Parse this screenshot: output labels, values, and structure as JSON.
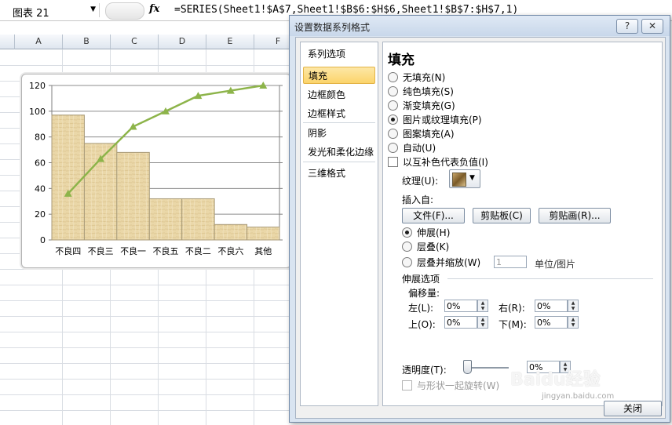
{
  "formula_bar": {
    "name_box": "图表 21",
    "fx": "fx",
    "formula": "=SERIES(Sheet1!$A$7,Sheet1!$B$6:$H$6,Sheet1!$B$7:$H$7,1)"
  },
  "sheet": {
    "columns": [
      "A",
      "B",
      "C",
      "D",
      "E",
      "F"
    ]
  },
  "chart_data": {
    "type": "bar",
    "categories": [
      "不良四",
      "不良三",
      "不良一",
      "不良五",
      "不良二",
      "不良六",
      "其他"
    ],
    "series": [
      {
        "values": [
          97,
          75,
          68,
          32,
          32,
          12,
          10
        ]
      },
      {
        "values": [
          36,
          63,
          88,
          100,
          112,
          116,
          120
        ]
      }
    ],
    "yticks": [
      "0",
      "20",
      "40",
      "60",
      "80",
      "100",
      "120"
    ],
    "ylim": [
      0,
      120
    ],
    "grid": true,
    "colors": {
      "bar_fill": "#ead7a8",
      "bar_stroke": "#a89a78",
      "line": "#8db44a"
    }
  },
  "dialog": {
    "title": "设置数据系列格式",
    "help": "?",
    "close_x": "✕",
    "nav": [
      "系列选项",
      "填充",
      "边框颜色",
      "边框样式",
      "阴影",
      "发光和柔化边缘",
      "三维格式"
    ],
    "nav_selected": "填充",
    "panel": {
      "title": "填充",
      "fill_options": [
        "无填充(N)",
        "纯色填充(S)",
        "渐变填充(G)",
        "图片或纹理填充(P)",
        "图案填充(A)",
        "自动(U)"
      ],
      "fill_selected": "图片或纹理填充(P)",
      "invert_if_negative": "以互补色代表负值(I)",
      "texture_label": "纹理(U):",
      "insert_from": "插入自:",
      "buttons": [
        "文件(F)...",
        "剪贴板(C)",
        "剪贴画(R)..."
      ],
      "stretch_options": [
        "伸展(H)",
        "层叠(K)",
        "层叠并缩放(W)"
      ],
      "stretch_selected": "伸展(H)",
      "units_value": "1",
      "units_label": "单位/图片",
      "stretch_section": "伸展选项",
      "offset_label": "偏移量:",
      "offsets": {
        "left": {
          "label": "左(L):",
          "value": "0%"
        },
        "right": {
          "label": "右(R):",
          "value": "0%"
        },
        "top": {
          "label": "上(O):",
          "value": "0%"
        },
        "bottom": {
          "label": "下(M):",
          "value": "0%"
        }
      },
      "transparency_label": "透明度(T):",
      "transparency_value": "0%",
      "rotate_with_shape": "与形状一起旋转(W)"
    },
    "close_button": "关闭"
  },
  "watermark": {
    "brand": "Baidu经验",
    "url": "jingyan.baidu.com"
  }
}
